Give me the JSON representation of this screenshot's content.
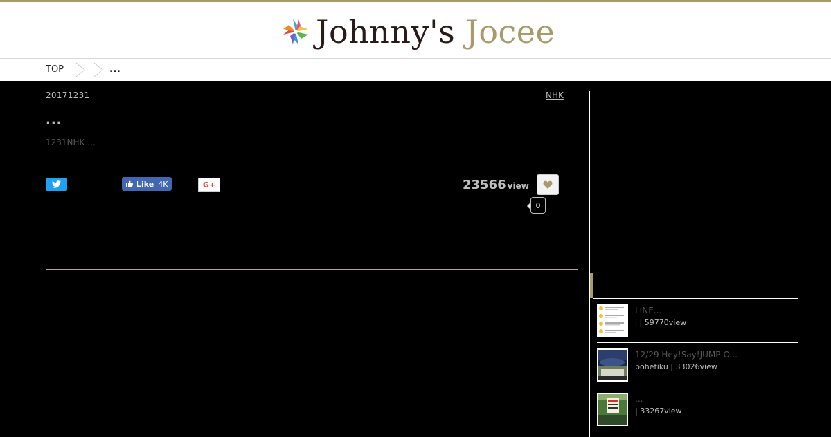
{
  "header": {
    "logo_primary": "Johnny's",
    "logo_accent": "Jocee",
    "accent_color": "#a89a6a"
  },
  "breadcrumb": {
    "items": [
      "TOP",
      "..."
    ]
  },
  "article": {
    "date": "20171231",
    "tag": "NHK",
    "title": "...",
    "summary": "1231NHK ...",
    "views": "23566",
    "views_unit": "view",
    "like_count": "0"
  },
  "share": {
    "facebook_label": "Like",
    "facebook_count": "4K",
    "google_label": "G+"
  },
  "sidebar": {
    "items": [
      {
        "title": "LINE...",
        "meta": "j | 59770view",
        "thumb": "chat-screenshot"
      },
      {
        "title": "12/29 Hey!Say!JUMP|O...",
        "meta": "bohetiku | 33026view",
        "thumb": "concert-venue"
      },
      {
        "title": "...",
        "meta": " | 33267view",
        "thumb": "green-sign-photo"
      }
    ]
  }
}
